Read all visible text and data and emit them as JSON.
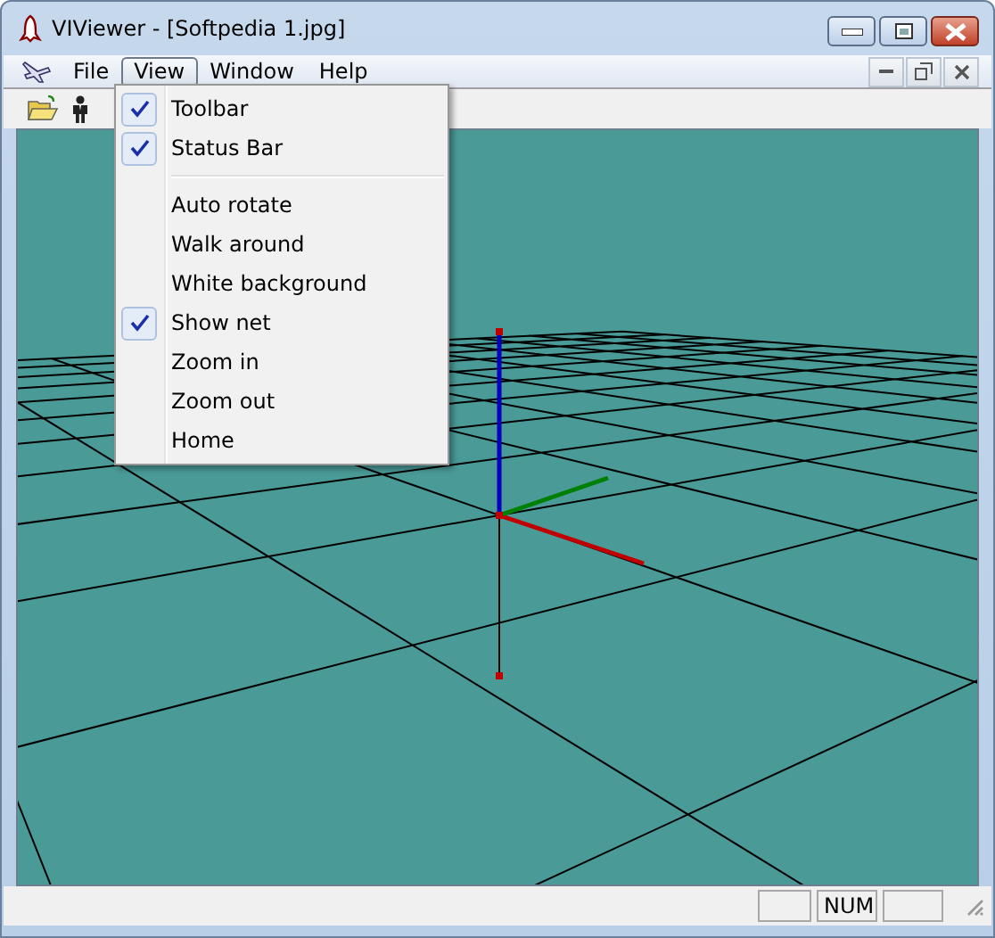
{
  "window": {
    "title": "VIViewer - [Softpedia 1.jpg]"
  },
  "menu_bar": [
    {
      "label": "File",
      "selected": false
    },
    {
      "label": "View",
      "selected": true
    },
    {
      "label": "Window",
      "selected": false
    },
    {
      "label": "Help",
      "selected": false
    }
  ],
  "view_menu": {
    "items": [
      {
        "kind": "item",
        "label": "Toolbar",
        "checked": true
      },
      {
        "kind": "item",
        "label": "Status Bar",
        "checked": true
      },
      {
        "kind": "separator"
      },
      {
        "kind": "item",
        "label": "Auto rotate",
        "checked": false
      },
      {
        "kind": "item",
        "label": "Walk around",
        "checked": false
      },
      {
        "kind": "item",
        "label": "White background",
        "checked": false
      },
      {
        "kind": "item",
        "label": "Show net",
        "checked": true
      },
      {
        "kind": "item",
        "label": "Zoom in",
        "checked": false
      },
      {
        "kind": "item",
        "label": "Zoom out",
        "checked": false
      },
      {
        "kind": "item",
        "label": "Home",
        "checked": false
      }
    ]
  },
  "status_bar": {
    "num_indicator": "NUM"
  }
}
